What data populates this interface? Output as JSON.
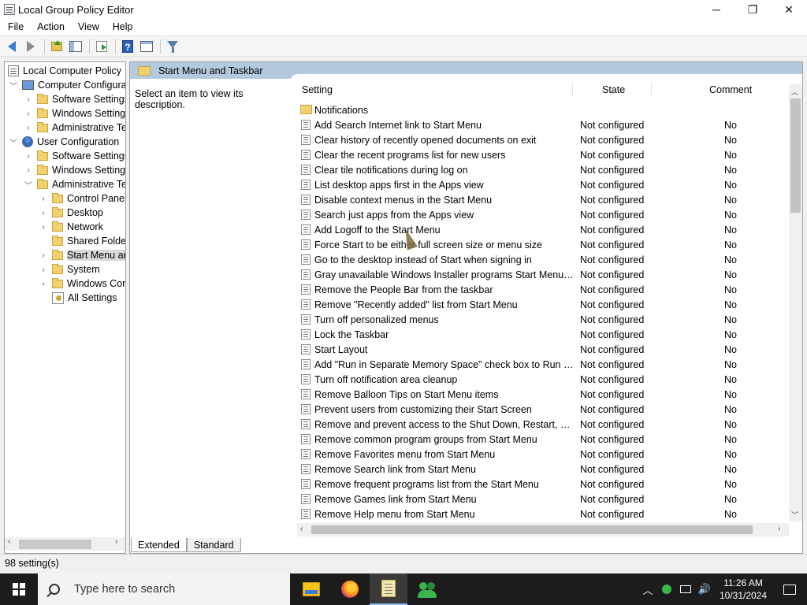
{
  "window": {
    "title": "Local Group Policy Editor",
    "minimize": "─",
    "maximize": "❐",
    "close": "✕"
  },
  "menu": {
    "items": [
      "File",
      "Action",
      "View",
      "Help"
    ]
  },
  "toolbar": {
    "icons": [
      "back-arrow-icon",
      "forward-arrow-icon",
      "up-folder-icon",
      "show-hide-tree-icon",
      "export-list-icon",
      "help-icon",
      "view-icon",
      "filter-icon"
    ]
  },
  "tree": {
    "items": [
      {
        "label": "Local Computer Policy",
        "icon": "policy-icon"
      },
      {
        "label": "Computer Configura",
        "icon": "computer-icon"
      },
      {
        "label": "Software Settings",
        "icon": "folder-icon"
      },
      {
        "label": "Windows Setting",
        "icon": "folder-icon"
      },
      {
        "label": "Administrative Te",
        "icon": "folder-icon"
      },
      {
        "label": "User Configuration",
        "icon": "user-icon"
      },
      {
        "label": "Software Settings",
        "icon": "folder-icon"
      },
      {
        "label": "Windows Setting",
        "icon": "folder-icon"
      },
      {
        "label": "Administrative Te",
        "icon": "folder-icon"
      },
      {
        "label": "Control Panel",
        "icon": "folder-icon"
      },
      {
        "label": "Desktop",
        "icon": "folder-icon"
      },
      {
        "label": "Network",
        "icon": "folder-icon"
      },
      {
        "label": "Shared Folder",
        "icon": "folder-icon"
      },
      {
        "label": "Start Menu ar",
        "icon": "folder-icon",
        "selected": true
      },
      {
        "label": "System",
        "icon": "folder-icon"
      },
      {
        "label": "Windows Cor",
        "icon": "folder-icon"
      },
      {
        "label": "All Settings",
        "icon": "all-settings-icon"
      }
    ]
  },
  "right": {
    "header_title": "Start Menu and Taskbar",
    "description": "Select an item to view its description.",
    "columns": {
      "setting": "Setting",
      "state": "State",
      "comment": "Comment"
    },
    "folder_row": "Notifications",
    "rows": [
      {
        "name": "Add Search Internet link to Start Menu",
        "state": "Not configured",
        "comment": "No"
      },
      {
        "name": "Clear history of recently opened documents on exit",
        "state": "Not configured",
        "comment": "No"
      },
      {
        "name": "Clear the recent programs list for new users",
        "state": "Not configured",
        "comment": "No"
      },
      {
        "name": "Clear tile notifications during log on",
        "state": "Not configured",
        "comment": "No"
      },
      {
        "name": "List desktop apps first in the Apps view",
        "state": "Not configured",
        "comment": "No"
      },
      {
        "name": "Disable context menus in the Start Menu",
        "state": "Not configured",
        "comment": "No"
      },
      {
        "name": "Search just apps from the Apps view",
        "state": "Not configured",
        "comment": "No"
      },
      {
        "name": "Add Logoff to the Start Menu",
        "state": "Not configured",
        "comment": "No"
      },
      {
        "name": "Force Start to be either full screen size or menu size",
        "state": "Not configured",
        "comment": "No"
      },
      {
        "name": "Go to the desktop instead of Start when signing in",
        "state": "Not configured",
        "comment": "No"
      },
      {
        "name": "Gray unavailable Windows Installer programs Start Menu sh...",
        "state": "Not configured",
        "comment": "No"
      },
      {
        "name": "Remove the People Bar from the taskbar",
        "state": "Not configured",
        "comment": "No"
      },
      {
        "name": "Remove \"Recently added\" list from Start Menu",
        "state": "Not configured",
        "comment": "No"
      },
      {
        "name": "Turn off personalized menus",
        "state": "Not configured",
        "comment": "No"
      },
      {
        "name": "Lock the Taskbar",
        "state": "Not configured",
        "comment": "No"
      },
      {
        "name": "Start Layout",
        "state": "Not configured",
        "comment": "No"
      },
      {
        "name": "Add \"Run in Separate Memory Space\" check box to Run dial...",
        "state": "Not configured",
        "comment": "No"
      },
      {
        "name": "Turn off notification area cleanup",
        "state": "Not configured",
        "comment": "No"
      },
      {
        "name": "Remove Balloon Tips on Start Menu items",
        "state": "Not configured",
        "comment": "No"
      },
      {
        "name": "Prevent users from customizing their Start Screen",
        "state": "Not configured",
        "comment": "No"
      },
      {
        "name": "Remove and prevent access to the Shut Down, Restart, Sleep...",
        "state": "Not configured",
        "comment": "No"
      },
      {
        "name": "Remove common program groups from Start Menu",
        "state": "Not configured",
        "comment": "No"
      },
      {
        "name": "Remove Favorites menu from Start Menu",
        "state": "Not configured",
        "comment": "No"
      },
      {
        "name": "Remove Search link from Start Menu",
        "state": "Not configured",
        "comment": "No"
      },
      {
        "name": "Remove frequent programs list from the Start Menu",
        "state": "Not configured",
        "comment": "No"
      },
      {
        "name": "Remove Games link from Start Menu",
        "state": "Not configured",
        "comment": "No"
      },
      {
        "name": "Remove Help menu from Start Menu",
        "state": "Not configured",
        "comment": "No"
      }
    ]
  },
  "tabs": {
    "extended": "Extended",
    "standard": "Standard"
  },
  "status": {
    "text": "98 setting(s)"
  },
  "taskbar": {
    "search_placeholder": "Type here to search",
    "apps": [
      "file-explorer-icon",
      "firefox-icon",
      "group-policy-editor-icon",
      "users-icon"
    ],
    "time": "11:26 AM",
    "date": "10/31/2024",
    "tray_chevron": "︿",
    "tray_volume": "🔊"
  },
  "colors": {
    "header_bg": "#b3c9de",
    "taskbar_bg": "#1c1c1c",
    "selection_bg": "#d9d9d9"
  }
}
